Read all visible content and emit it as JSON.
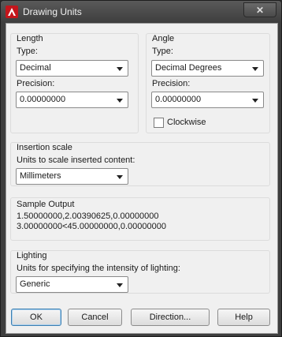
{
  "window": {
    "title": "Drawing Units",
    "close_glyph": "✕"
  },
  "length": {
    "group_label": "Length",
    "type_label": "Type:",
    "type_value": "Decimal",
    "precision_label": "Precision:",
    "precision_value": "0.00000000"
  },
  "angle": {
    "group_label": "Angle",
    "type_label": "Type:",
    "type_value": "Decimal Degrees",
    "precision_label": "Precision:",
    "precision_value": "0.00000000",
    "clockwise_label": "Clockwise",
    "clockwise_checked": false
  },
  "insertion": {
    "group_label": "Insertion scale",
    "units_label": "Units to scale inserted content:",
    "units_value": "Millimeters"
  },
  "sample": {
    "group_label": "Sample Output",
    "line1": "1.50000000,2.00390625,0.00000000",
    "line2": "3.00000000<45.00000000,0.00000000"
  },
  "lighting": {
    "group_label": "Lighting",
    "units_label": "Units for specifying the intensity of lighting:",
    "units_value": "Generic"
  },
  "buttons": {
    "ok": "OK",
    "cancel": "Cancel",
    "direction": "Direction...",
    "help": "Help"
  },
  "colors": {
    "title_bar": "#3e3e3e",
    "app_icon": "#c4161c",
    "dialog_bg": "#f0f0f0"
  },
  "icons": {
    "app": "autocad-logo-icon",
    "close": "close-icon",
    "dropdown": "chevron-down-icon"
  }
}
